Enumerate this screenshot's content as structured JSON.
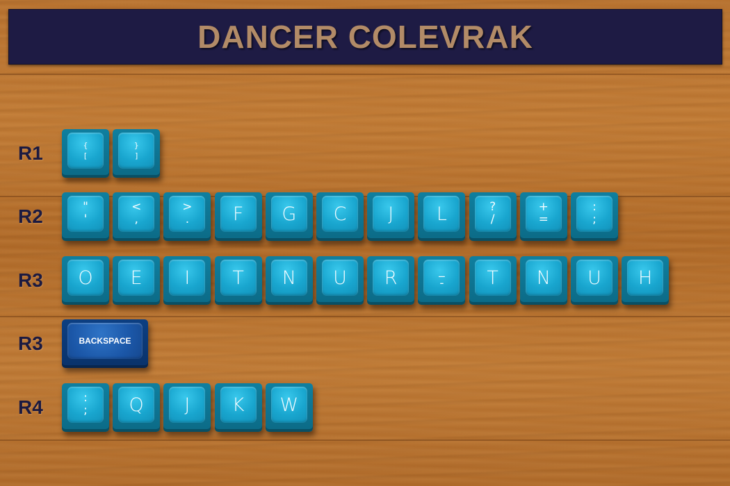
{
  "title": "DANCER COLEVRAK",
  "colors": {
    "banner_bg": "#1e1b44",
    "title_text": "#b28b67",
    "key_cyan": "#19a6cf",
    "key_blue": "#1b57a8",
    "label_navy": "#1c1a40"
  },
  "rows": [
    {
      "label": "R1",
      "keys": [
        {
          "legend": "{\n["
        },
        {
          "legend": "}\n]"
        }
      ]
    },
    {
      "label": "R2",
      "keys": [
        {
          "legend": "\"\n'"
        },
        {
          "legend": "<\n,"
        },
        {
          "legend": ">\n."
        },
        {
          "legend": "F"
        },
        {
          "legend": "G"
        },
        {
          "legend": "C"
        },
        {
          "legend": "J"
        },
        {
          "legend": "L"
        },
        {
          "legend": "?\n/"
        },
        {
          "legend": "+\n="
        },
        {
          "legend": ":\n;"
        }
      ]
    },
    {
      "label": "R3",
      "keys": [
        {
          "legend": "O"
        },
        {
          "legend": "E"
        },
        {
          "legend": "I"
        },
        {
          "legend": "T"
        },
        {
          "legend": "N"
        },
        {
          "legend": "U"
        },
        {
          "legend": "R"
        },
        {
          "legend": "_\n-"
        },
        {
          "legend": "T"
        },
        {
          "legend": "N"
        },
        {
          "legend": "U"
        },
        {
          "legend": "H"
        }
      ]
    },
    {
      "label": "R3",
      "keys": [
        {
          "legend": "BACKSPACE",
          "style": "wide"
        }
      ]
    },
    {
      "label": "R4",
      "keys": [
        {
          "legend": ":\n;"
        },
        {
          "legend": "Q"
        },
        {
          "legend": "J"
        },
        {
          "legend": "K"
        },
        {
          "legend": "W"
        }
      ]
    }
  ]
}
